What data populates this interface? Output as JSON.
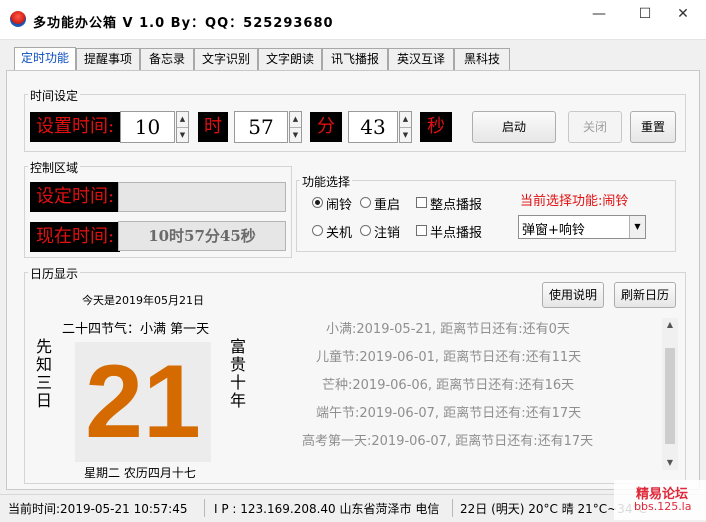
{
  "window": {
    "title": "多功能办公箱 V 1.0  By：QQ：525293680",
    "minimize": "—",
    "maximize": "☐",
    "close": "✕"
  },
  "tabs": [
    "定时功能",
    "提醒事项",
    "备忘录",
    "文字识别",
    "文字朗读",
    "讯飞播报",
    "英汉互译",
    "黑科技"
  ],
  "time_setting": {
    "group_label": "时间设定",
    "set_time_label": "设置时间:",
    "hour": "10",
    "hour_unit": "时",
    "minute": "57",
    "minute_unit": "分",
    "second": "43",
    "second_unit": "秒",
    "start_button": "启动",
    "close_button": "关闭",
    "reset_button": "重置"
  },
  "control": {
    "group_label": "控制区域",
    "set_time_label": "设定时间:",
    "set_time_value": "",
    "now_time_label": "现在时间:",
    "now_time_value": "10时57分45秒"
  },
  "function_select": {
    "group_label": "功能选择",
    "current_label": "当前选择功能:闹铃",
    "options": [
      "闹铃",
      "重启",
      "整点播报",
      "关机",
      "注销",
      "半点播报"
    ],
    "dropdown_value": "弹窗+响铃",
    "accent_color": "#e01010"
  },
  "calendar": {
    "group_label": "日历显示",
    "today_text": "今天是2019年05月21日",
    "solar_term_text": "二十四节气：小满 第一天",
    "left_vertical": "先知三日",
    "right_vertical": "富贵十年",
    "day_number": "21",
    "day_color": "#d46a00",
    "bottom_text": "星期二 农历四月十七",
    "help_button": "使用说明",
    "refresh_button": "刷新日历",
    "festivals": [
      "小满:2019-05-21, 距离节日还有:还有0天",
      "儿童节:2019-06-01, 距离节日还有:还有11天",
      "芒种:2019-06-06, 距离节日还有:还有16天",
      "端午节:2019-06-07, 距离节日还有:还有17天",
      "高考第一天:2019-06-07, 距离节日还有:还有17天"
    ]
  },
  "statusbar": {
    "current_time": "当前时间:2019-05-21 10:57:45",
    "ip": "I P :  123.169.208.40  山东省菏泽市 电信",
    "weather": "22日 (明天) 20°C 晴 21°C~34°C"
  },
  "watermark": {
    "line1": "精易论坛",
    "line2": "bbs.125.la"
  }
}
